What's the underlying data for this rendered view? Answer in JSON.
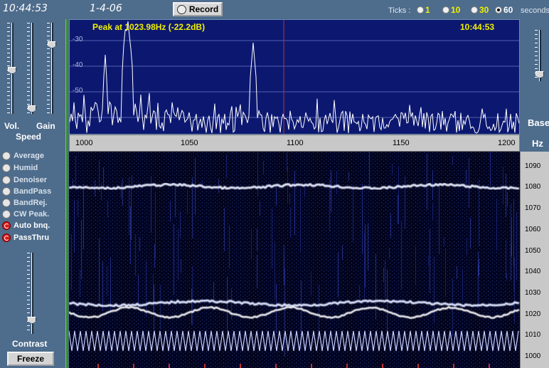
{
  "header": {
    "clock": "10:44:53",
    "date": "1-4-06",
    "record_label": "Record",
    "ticks_label": "Ticks :",
    "tick_options": [
      {
        "value": "1",
        "selected": false
      },
      {
        "value": "10",
        "selected": false
      },
      {
        "value": "30",
        "selected": false
      },
      {
        "value": "60",
        "selected": true
      }
    ],
    "seconds_label": "seconds"
  },
  "left_panel": {
    "volume_label": "Vol.",
    "speed_label": "Speed",
    "gain_label": "Gain",
    "options": [
      {
        "label": "Average",
        "active": false
      },
      {
        "label": "Humid",
        "active": false
      },
      {
        "label": "Denoiser",
        "active": false
      },
      {
        "label": "BandPass",
        "active": false
      },
      {
        "label": "BandRej.",
        "active": false
      },
      {
        "label": "CW Peak.",
        "active": false
      },
      {
        "label": "Auto bnq.",
        "active": true
      },
      {
        "label": "PassThru",
        "active": true
      }
    ],
    "contrast_label": "Contrast",
    "freeze_label": "Freeze"
  },
  "spectrum": {
    "peak_text": "Peak at 1023.98Hz (-22.2dB)",
    "clock": "10:44:53",
    "db_labels": [
      "-30",
      "-40",
      "-50"
    ],
    "x_ticks": [
      "1000",
      "1050",
      "1100",
      "1150",
      "1200"
    ],
    "x_range": [
      995,
      1205
    ]
  },
  "waterfall": {
    "y_ticks": [
      "1090",
      "1080",
      "1070",
      "1060",
      "1050",
      "1040",
      "1030",
      "1020",
      "1010",
      "1000"
    ],
    "y_range": [
      997,
      1095
    ]
  },
  "right_panel": {
    "base_label": "Base",
    "hz_label": "Hz"
  },
  "colors": {
    "panel": "#4e6c8c",
    "spectrum_bg": "#0c1870",
    "waterfall_bg": "#02041e",
    "accent_yellow": "#f0f000",
    "marker_red": "#c03030"
  }
}
